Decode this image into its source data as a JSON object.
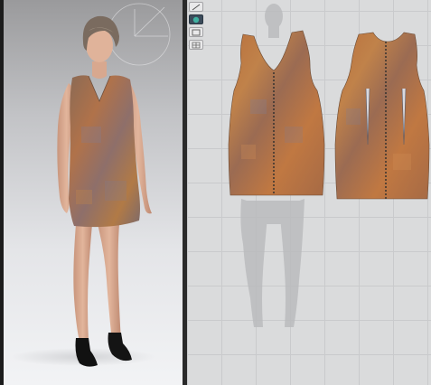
{
  "app": {
    "panels": {
      "avatar_view": "3d",
      "pattern_view": "2d"
    },
    "colors": {
      "fabric_base": "#b8733f",
      "fabric_shade": "#8a5a3a",
      "fabric_accent": "#7a7fa0",
      "stitch_line": "#3a3a3a",
      "avatar_silhouette": "#b9babc",
      "viewport_3d_top": "#9a9a9c",
      "viewport_2d_bg": "#dadbdc"
    },
    "toolbar_icons": [
      "gizmo-icon",
      "sphere-icon",
      "layer-icon",
      "grid-icon"
    ]
  }
}
